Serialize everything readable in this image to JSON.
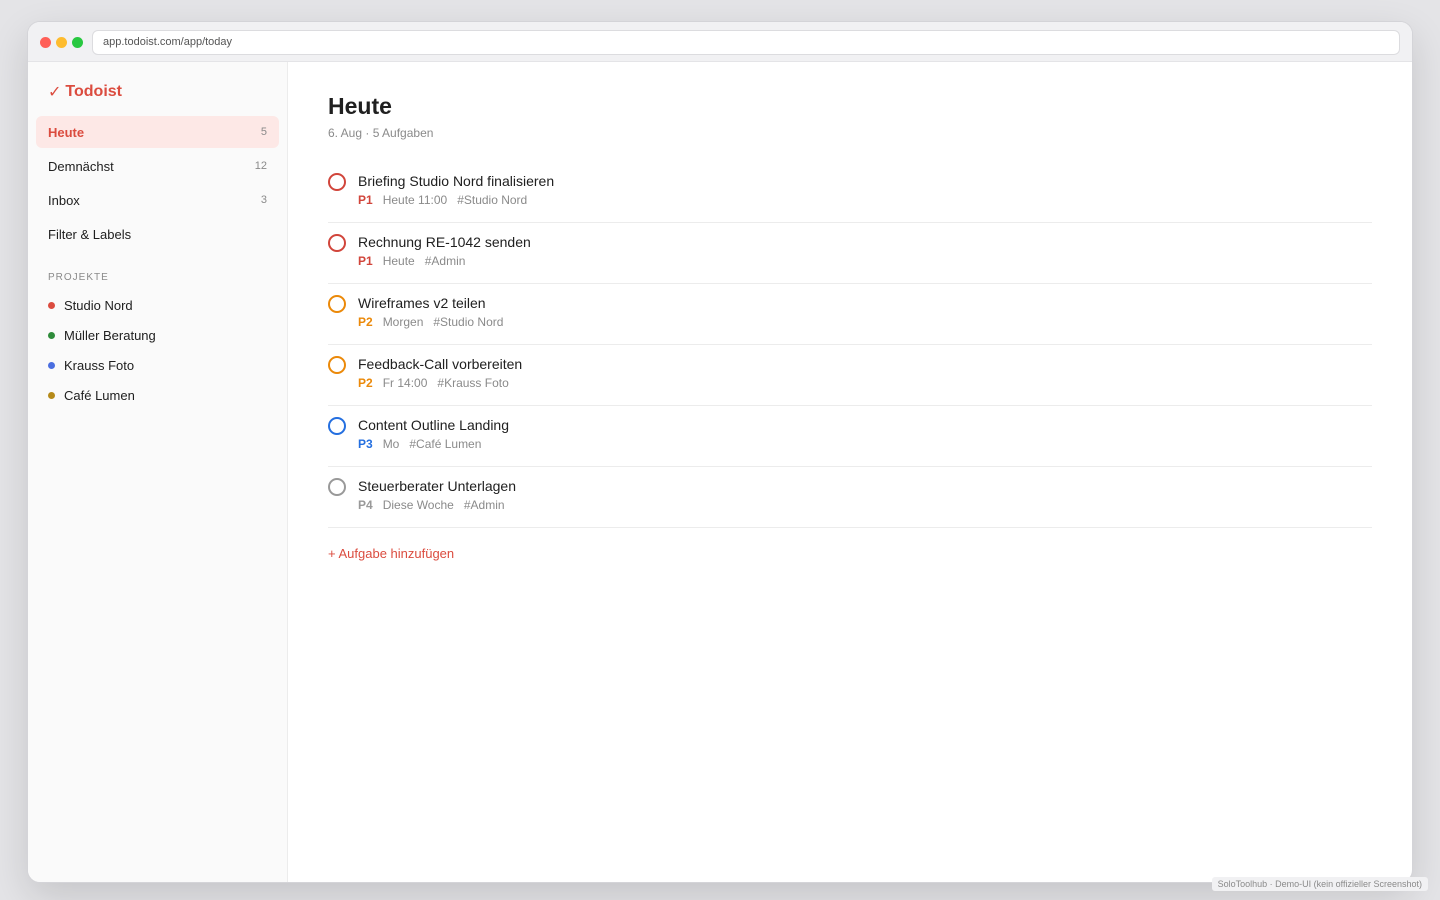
{
  "browser": {
    "url": "app.todoist.com/app/today"
  },
  "brand": {
    "check": "✓",
    "name": "Todoist",
    "color": "#db4c3f"
  },
  "nav": [
    {
      "label": "Heute",
      "count": "5",
      "active": true
    },
    {
      "label": "Demnächst",
      "count": "12"
    },
    {
      "label": "Inbox",
      "count": "3"
    },
    {
      "label": "Filter & Labels",
      "count": ""
    }
  ],
  "projects_label": "PROJEKTE",
  "projects": [
    {
      "name": "Studio Nord",
      "color": "#db4c3f"
    },
    {
      "name": "Müller Beratung",
      "color": "#2e8b3a"
    },
    {
      "name": "Krauss Foto",
      "color": "#4a6ee0"
    },
    {
      "name": "Café Lumen",
      "color": "#b58a1a"
    }
  ],
  "main": {
    "title": "Heute",
    "subtitle": "6. Aug · 5 Aufgaben",
    "add_task": "+ Aufgabe hinzufügen"
  },
  "priority_colors": {
    "P1": "#d1453b",
    "P2": "#eb8909",
    "P3": "#246fe0",
    "P4": "#999999"
  },
  "tasks": [
    {
      "title": "Briefing Studio Nord finalisieren",
      "priority": "P1",
      "due": "Heute 11:00",
      "project": "#Studio Nord"
    },
    {
      "title": "Rechnung RE-1042 senden",
      "priority": "P1",
      "due": "Heute",
      "project": "#Admin"
    },
    {
      "title": "Wireframes v2 teilen",
      "priority": "P2",
      "due": "Morgen",
      "project": "#Studio Nord"
    },
    {
      "title": "Feedback-Call vorbereiten",
      "priority": "P2",
      "due": "Fr 14:00",
      "project": "#Krauss Foto"
    },
    {
      "title": "Content Outline Landing",
      "priority": "P3",
      "due": "Mo",
      "project": "#Café Lumen"
    },
    {
      "title": "Steuerberater Unterlagen",
      "priority": "P4",
      "due": "Diese Woche",
      "project": "#Admin"
    }
  ],
  "footnote": "SoloToolhub · Demo-UI (kein offizieller Screenshot)"
}
